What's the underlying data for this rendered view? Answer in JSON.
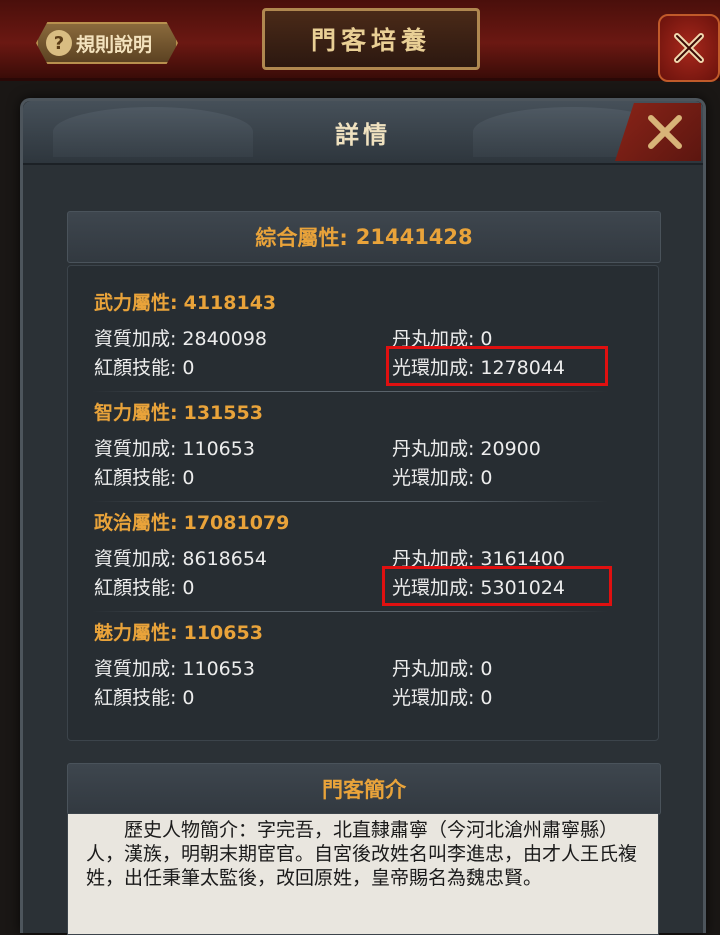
{
  "topbar": {
    "rules_label": "規則說明",
    "title": "門客培養"
  },
  "modal": {
    "title": "詳情",
    "total": {
      "label": "綜合屬性:",
      "value": "21441428"
    },
    "groups": [
      {
        "title": "武力屬性:",
        "value": "4118143",
        "quality": {
          "label": "資質加成:",
          "value": "2840098"
        },
        "pill": {
          "label": "丹丸加成:",
          "value": "0"
        },
        "beauty": {
          "label": "紅顏技能:",
          "value": "0"
        },
        "halo": {
          "label": "光環加成:",
          "value": "1278044"
        }
      },
      {
        "title": "智力屬性:",
        "value": "131553",
        "quality": {
          "label": "資質加成:",
          "value": "110653"
        },
        "pill": {
          "label": "丹丸加成:",
          "value": "20900"
        },
        "beauty": {
          "label": "紅顏技能:",
          "value": "0"
        },
        "halo": {
          "label": "光環加成:",
          "value": "0"
        }
      },
      {
        "title": "政治屬性:",
        "value": "17081079",
        "quality": {
          "label": "資質加成:",
          "value": "8618654"
        },
        "pill": {
          "label": "丹丸加成:",
          "value": "3161400"
        },
        "beauty": {
          "label": "紅顏技能:",
          "value": "0"
        },
        "halo": {
          "label": "光環加成:",
          "value": "5301024"
        }
      },
      {
        "title": "魅力屬性:",
        "value": "110653",
        "quality": {
          "label": "資質加成:",
          "value": "110653"
        },
        "pill": {
          "label": "丹丸加成:",
          "value": "0"
        },
        "beauty": {
          "label": "紅顏技能:",
          "value": "0"
        },
        "halo": {
          "label": "光環加成:",
          "value": "0"
        }
      }
    ],
    "bio": {
      "title": "門客簡介",
      "text": "歷史人物簡介：字完吾，北直隸肅寧（今河北滄州肅寧縣）人，漢族，明朝末期宦官。自宮後改姓名叫李進忠，由才人王氏複姓，出任秉筆太監後，改回原姓，皇帝賜名為魏忠賢。"
    }
  },
  "colors": {
    "accent": "#e9a33a",
    "highlight": "#e01010"
  }
}
